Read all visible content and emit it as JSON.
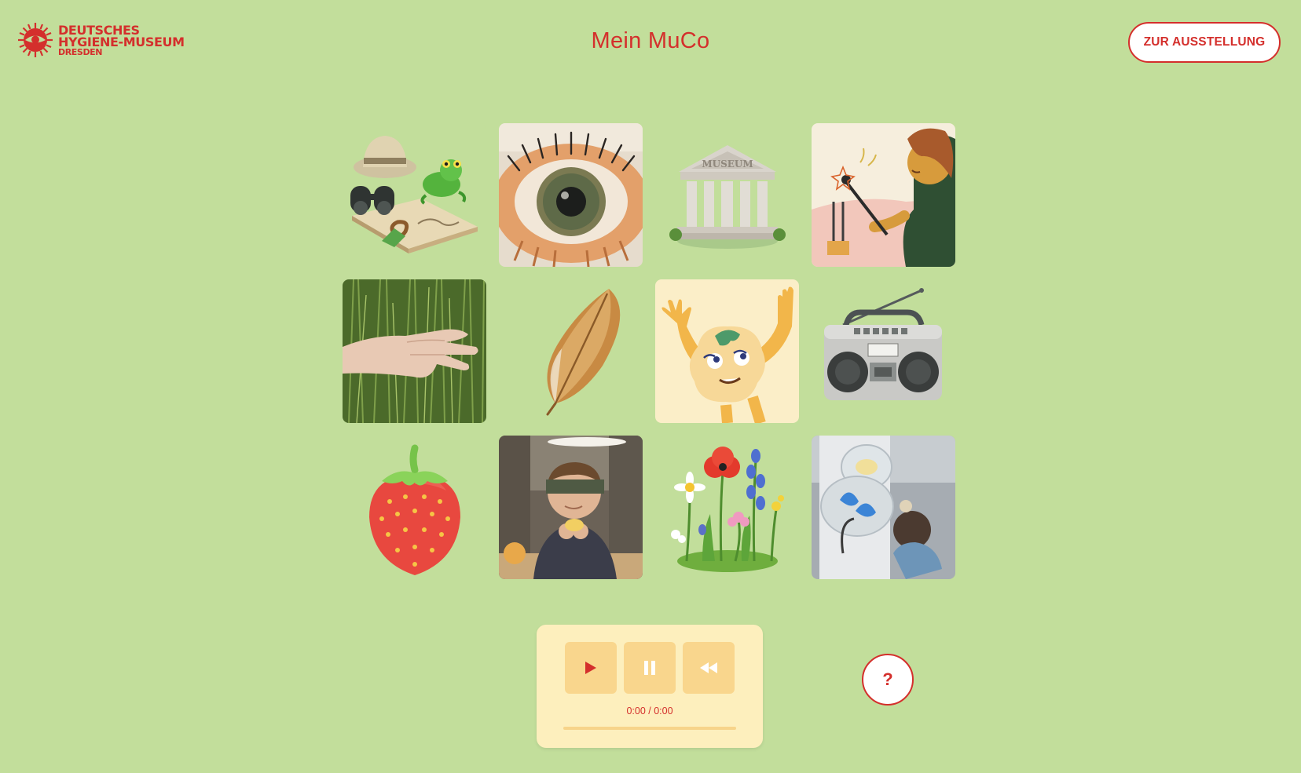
{
  "header": {
    "logo_line1": "DEUTSCHES",
    "logo_line2": "HYGIENE-MUSEUM",
    "logo_line3": "DRESDEN",
    "title": "Mein MuCo",
    "exhibit_button": "ZUR AUSSTELLUNG"
  },
  "tiles": [
    {
      "icon": "explorer-kit-icon"
    },
    {
      "icon": "eye-model-icon"
    },
    {
      "icon": "museum-building-icon",
      "label": "MUSEUM"
    },
    {
      "icon": "tuning-fork-illustration-icon"
    },
    {
      "icon": "hand-in-grass-icon"
    },
    {
      "icon": "feather-icon"
    },
    {
      "icon": "muco-mascot-icon"
    },
    {
      "icon": "boombox-radio-icon"
    },
    {
      "icon": "strawberry-icon"
    },
    {
      "icon": "blindfolded-child-icon"
    },
    {
      "icon": "wildflowers-icon"
    },
    {
      "icon": "child-at-exhibit-icon"
    }
  ],
  "player": {
    "time": "0:00 / 0:00",
    "progress": 0
  },
  "help_button": "?",
  "colors": {
    "background": "#c2de9b",
    "accent": "#d42f2c",
    "player_bg": "#fdefbd",
    "player_button": "#f9d68d"
  }
}
